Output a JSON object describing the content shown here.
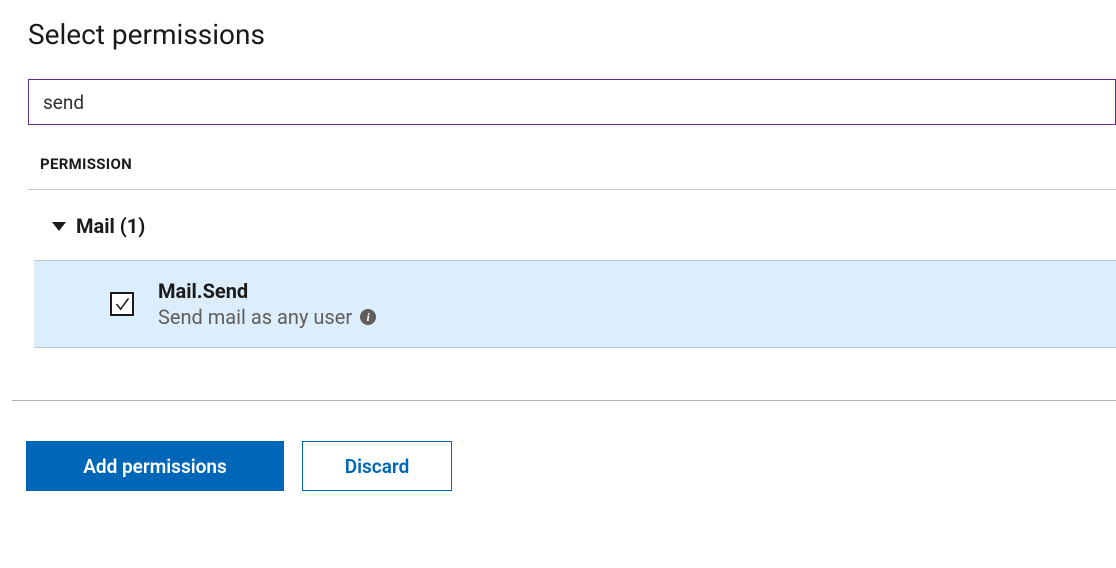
{
  "header": {
    "title": "Select permissions"
  },
  "search": {
    "value": "send",
    "placeholder": ""
  },
  "table": {
    "column_header": "PERMISSION"
  },
  "groups": [
    {
      "label": "Mail (1)",
      "expanded": true,
      "permissions": [
        {
          "checked": true,
          "name": "Mail.Send",
          "description": "Send mail as any user"
        }
      ]
    }
  ],
  "footer": {
    "primary": "Add permissions",
    "secondary": "Discard"
  }
}
